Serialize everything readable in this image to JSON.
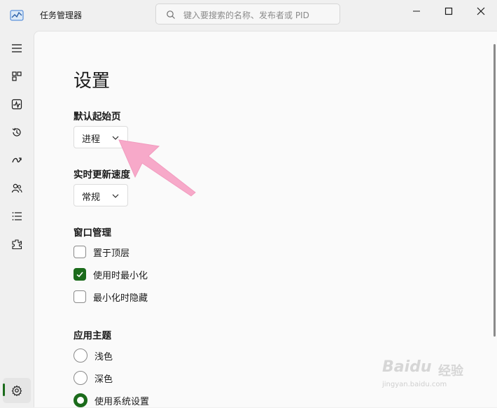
{
  "window": {
    "title": "任务管理器",
    "search_placeholder": "键入要搜索的名称、发布者或 PID"
  },
  "nav": {
    "items": [
      {
        "name": "hamburger-menu-icon"
      },
      {
        "name": "processes-icon"
      },
      {
        "name": "performance-icon"
      },
      {
        "name": "app-history-icon"
      },
      {
        "name": "startup-apps-icon"
      },
      {
        "name": "users-icon"
      },
      {
        "name": "details-icon"
      },
      {
        "name": "services-icon"
      },
      {
        "name": "settings-icon"
      }
    ]
  },
  "settings": {
    "page_title": "设置",
    "default_start_page": {
      "label": "默认起始页",
      "value": "进程"
    },
    "realtime_update_speed": {
      "label": "实时更新速度",
      "value": "常规"
    },
    "window_management": {
      "label": "窗口管理",
      "options": [
        {
          "label": "置于顶层",
          "checked": false
        },
        {
          "label": "使用时最小化",
          "checked": true
        },
        {
          "label": "最小化时隐藏",
          "checked": false
        }
      ]
    },
    "app_theme": {
      "label": "应用主题",
      "options": [
        {
          "label": "浅色",
          "selected": false
        },
        {
          "label": "深色",
          "selected": false
        },
        {
          "label": "使用系统设置",
          "selected": true
        }
      ]
    }
  },
  "watermark": {
    "brand": "Baidu",
    "sub": "经验",
    "url": "jingyan.baidu.com"
  },
  "colors": {
    "accent": "#1b6b1b",
    "arrow": "#f7a9c9"
  }
}
